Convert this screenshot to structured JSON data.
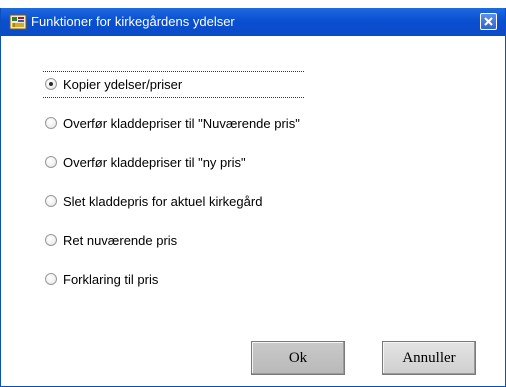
{
  "window": {
    "title": "Funktioner for kirkegårdens ydelser",
    "close_icon": "close-icon",
    "app_icon": "cemetery-app-icon"
  },
  "options": [
    {
      "label": "Kopier ydelser/priser",
      "selected": true
    },
    {
      "label": "Overfør kladdepriser til \"Nuværende pris\"",
      "selected": false
    },
    {
      "label": "Overfør kladdepriser til \"ny pris\"",
      "selected": false
    },
    {
      "label": "Slet kladdepris for aktuel kirkegård",
      "selected": false
    },
    {
      "label": "Ret nuværende pris",
      "selected": false
    },
    {
      "label": "Forklaring til pris",
      "selected": false
    }
  ],
  "buttons": {
    "ok_label": "Ok",
    "cancel_label": "Annuller"
  },
  "colors": {
    "titlebar": "#0a4fd1",
    "accent": "#1e6ae0"
  }
}
